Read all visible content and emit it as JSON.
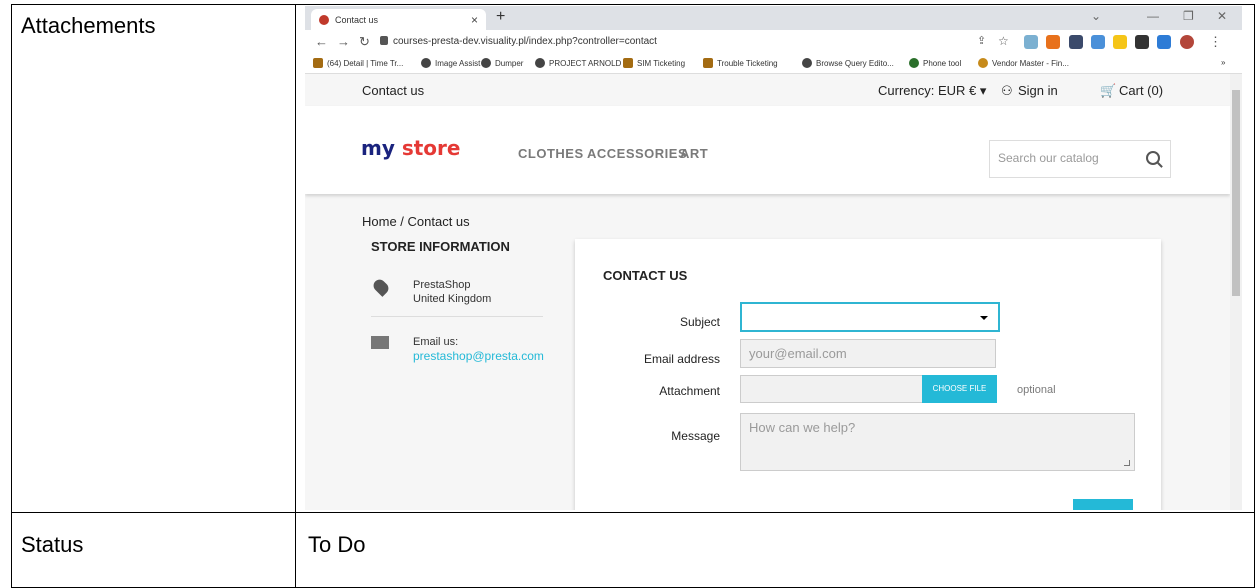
{
  "document": {
    "row1_label": "Attachements",
    "row2_label": "Status",
    "row2_value": "To Do"
  },
  "browser": {
    "tab_title": "Contact us",
    "tab_close": "×",
    "new_tab": "+",
    "url": "courses-presta-dev.visuality.pl/index.php?controller=contact",
    "bookmarks": [
      "(64) Detail | Time Tr...",
      "Image Assist",
      "Dumper",
      "PROJECT ARNOLD",
      "SIM Ticketing",
      "Trouble Ticketing",
      "Browse Query Edito...",
      "Phone tool",
      "Vendor Master - Fin..."
    ],
    "bookmarks_more": "»"
  },
  "store": {
    "topnav": {
      "contact": "Contact us",
      "currency": "Currency: EUR € ▾",
      "signin": "Sign in",
      "cart": "Cart (0)"
    },
    "logo_my": "my ",
    "logo_store": "store",
    "menu": [
      "CLOTHES",
      "ACCESSORIES",
      "ART"
    ],
    "search_placeholder": "Search our catalog",
    "breadcrumb": "Home  /  Contact us",
    "store_info_title": "STORE INFORMATION",
    "store_name": "PrestaShop",
    "store_country": "United Kingdom",
    "email_label": "Email us:",
    "email_value": "prestashop@presta.com"
  },
  "form": {
    "title": "CONTACT US",
    "subject_label": "Subject",
    "email_label": "Email address",
    "email_placeholder": "your@email.com",
    "attachment_label": "Attachment",
    "choose_file": "CHOOSE FILE",
    "optional": "optional",
    "message_label": "Message",
    "message_placeholder": "How can we help?"
  },
  "colors": {
    "accent": "#24b9d7",
    "focus_border": "#2fb5d2"
  }
}
